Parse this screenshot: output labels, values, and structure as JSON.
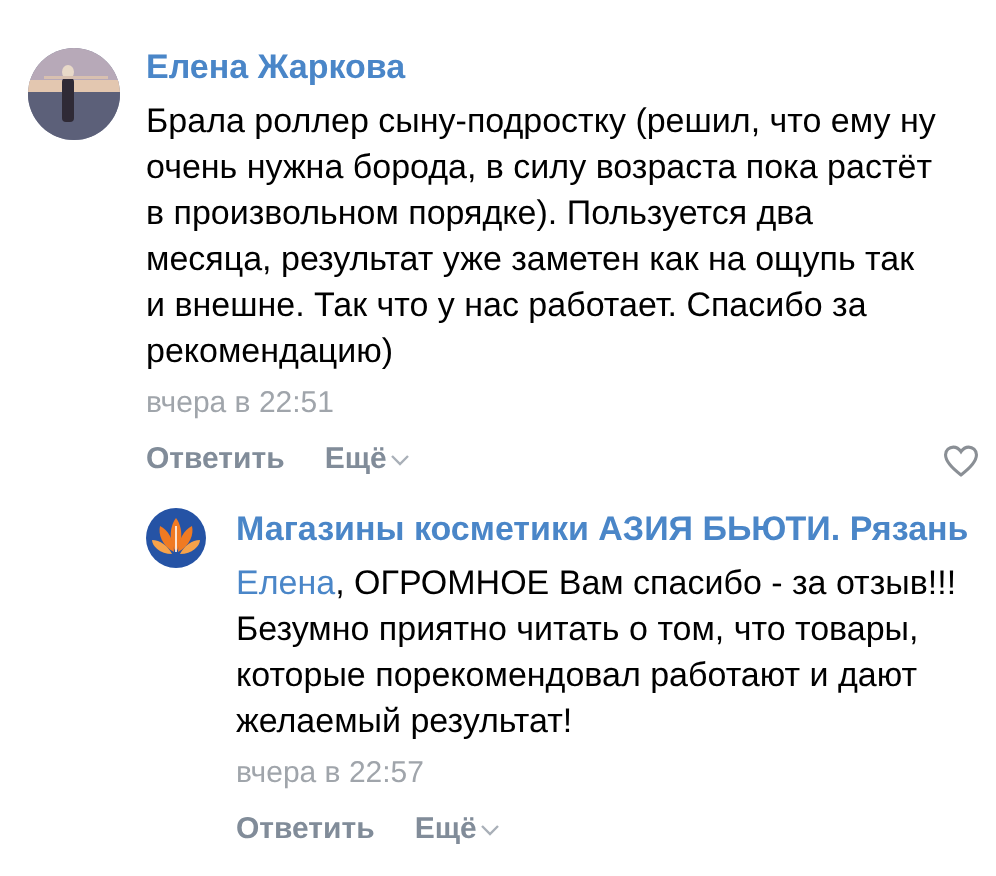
{
  "comments": [
    {
      "author": "Елена Жаркова",
      "text": "Брала роллер сыну-подростку (решил, что ему ну очень нужна борода, в силу возраста пока растёт в произвольном порядке). Пользуется два месяца, результат уже заметен как на ощупь так и внешне. Так что у нас работает. Спасибо за рекомендацию)",
      "time": "вчера в 22:51",
      "reply": "Ответить",
      "more": "Ещё",
      "like": true,
      "replies": [
        {
          "kind": "logo",
          "author": "Магазины косметики АЗИЯ БЬЮТИ. Рязань",
          "mention": "Елена",
          "text": ", ОГРОМНОЕ Вам спасибо - за отзыв!!! Безумно приятно читать о том, что товары, которые порекомендовал работают и дают желаемый результат!",
          "time": "вчера в 22:57",
          "reply": "Ответить",
          "more": "Ещё",
          "like": false
        }
      ]
    }
  ]
}
